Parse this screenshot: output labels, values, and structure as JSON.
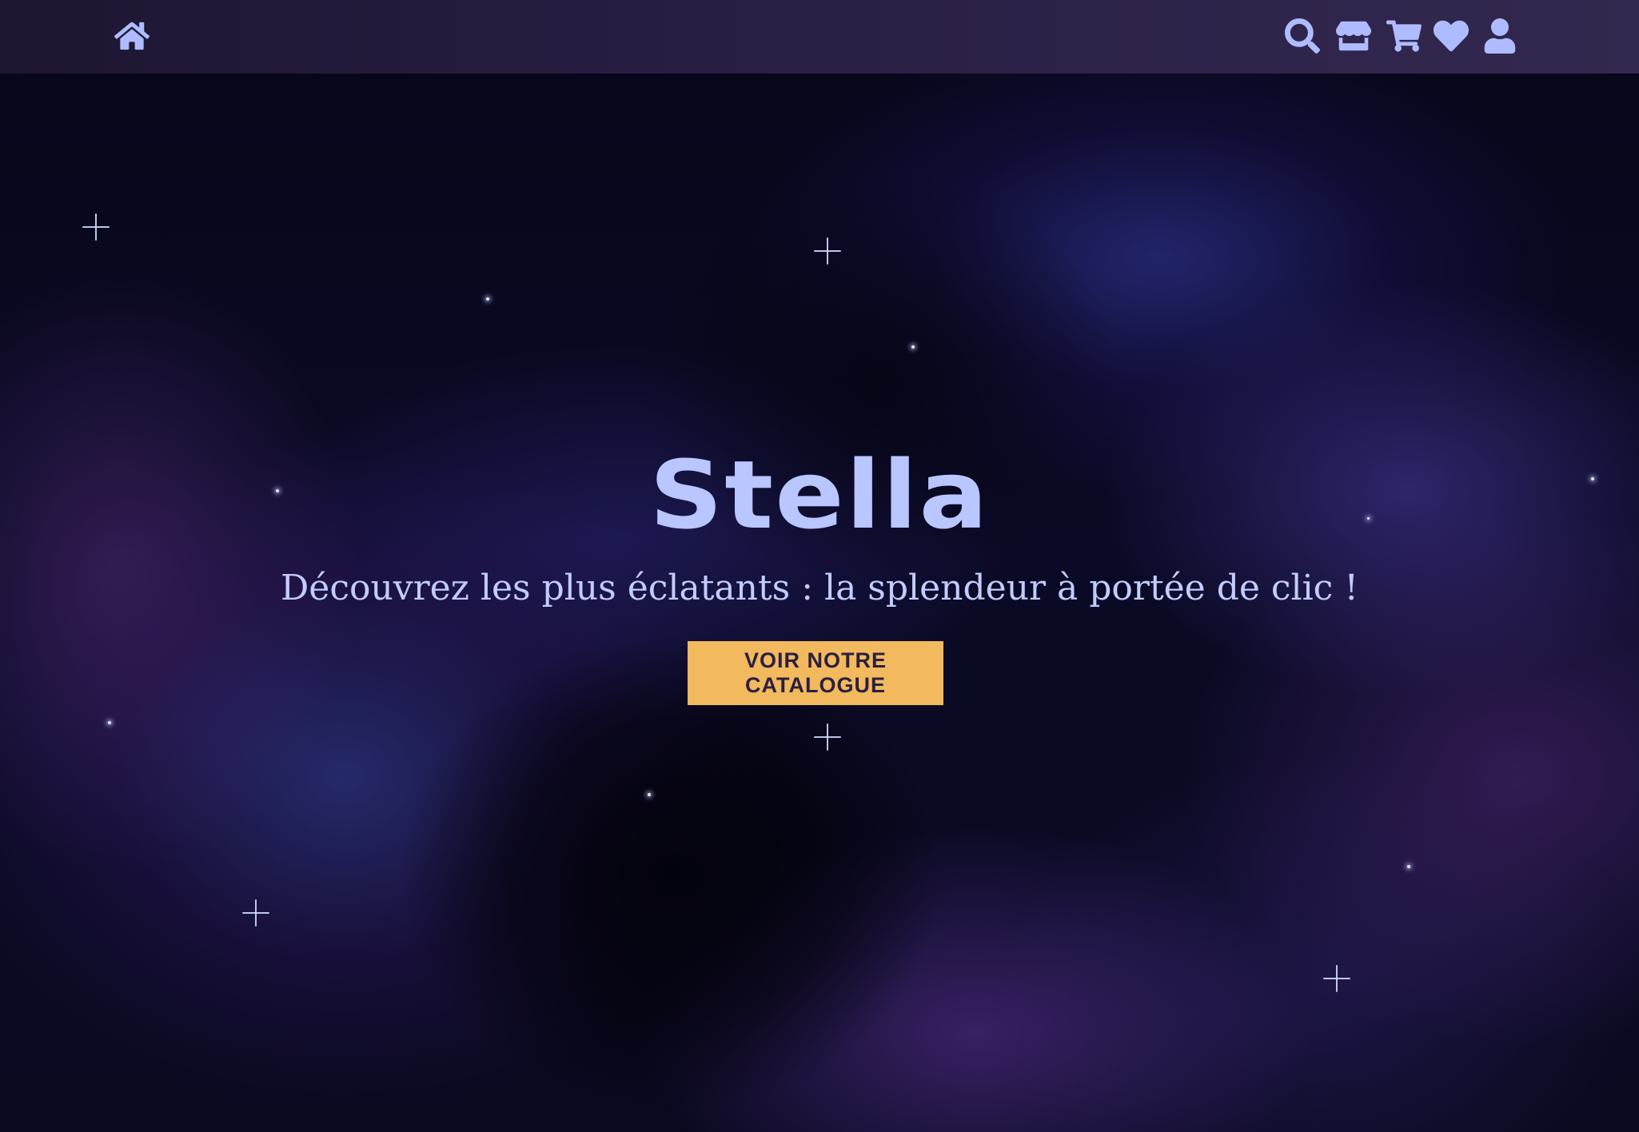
{
  "navbar": {
    "left_icons": [
      {
        "icon": "home-icon"
      }
    ],
    "right_icons": [
      {
        "icon": "search-icon"
      },
      {
        "icon": "store-icon"
      },
      {
        "icon": "cart-icon"
      },
      {
        "icon": "heart-icon"
      },
      {
        "icon": "user-icon"
      }
    ],
    "icon_color": "#aebcff",
    "background_color": "#2a1f45"
  },
  "hero": {
    "title": "Stella",
    "subtitle": "Découvrez les plus éclatants : la splendeur à portée de clic !",
    "cta_label": "VOIR NOTRE CATALOGUE",
    "cta_color": "#f2b95e",
    "text_color": "#b9c6ff",
    "background": "galaxy-nebula-image"
  }
}
